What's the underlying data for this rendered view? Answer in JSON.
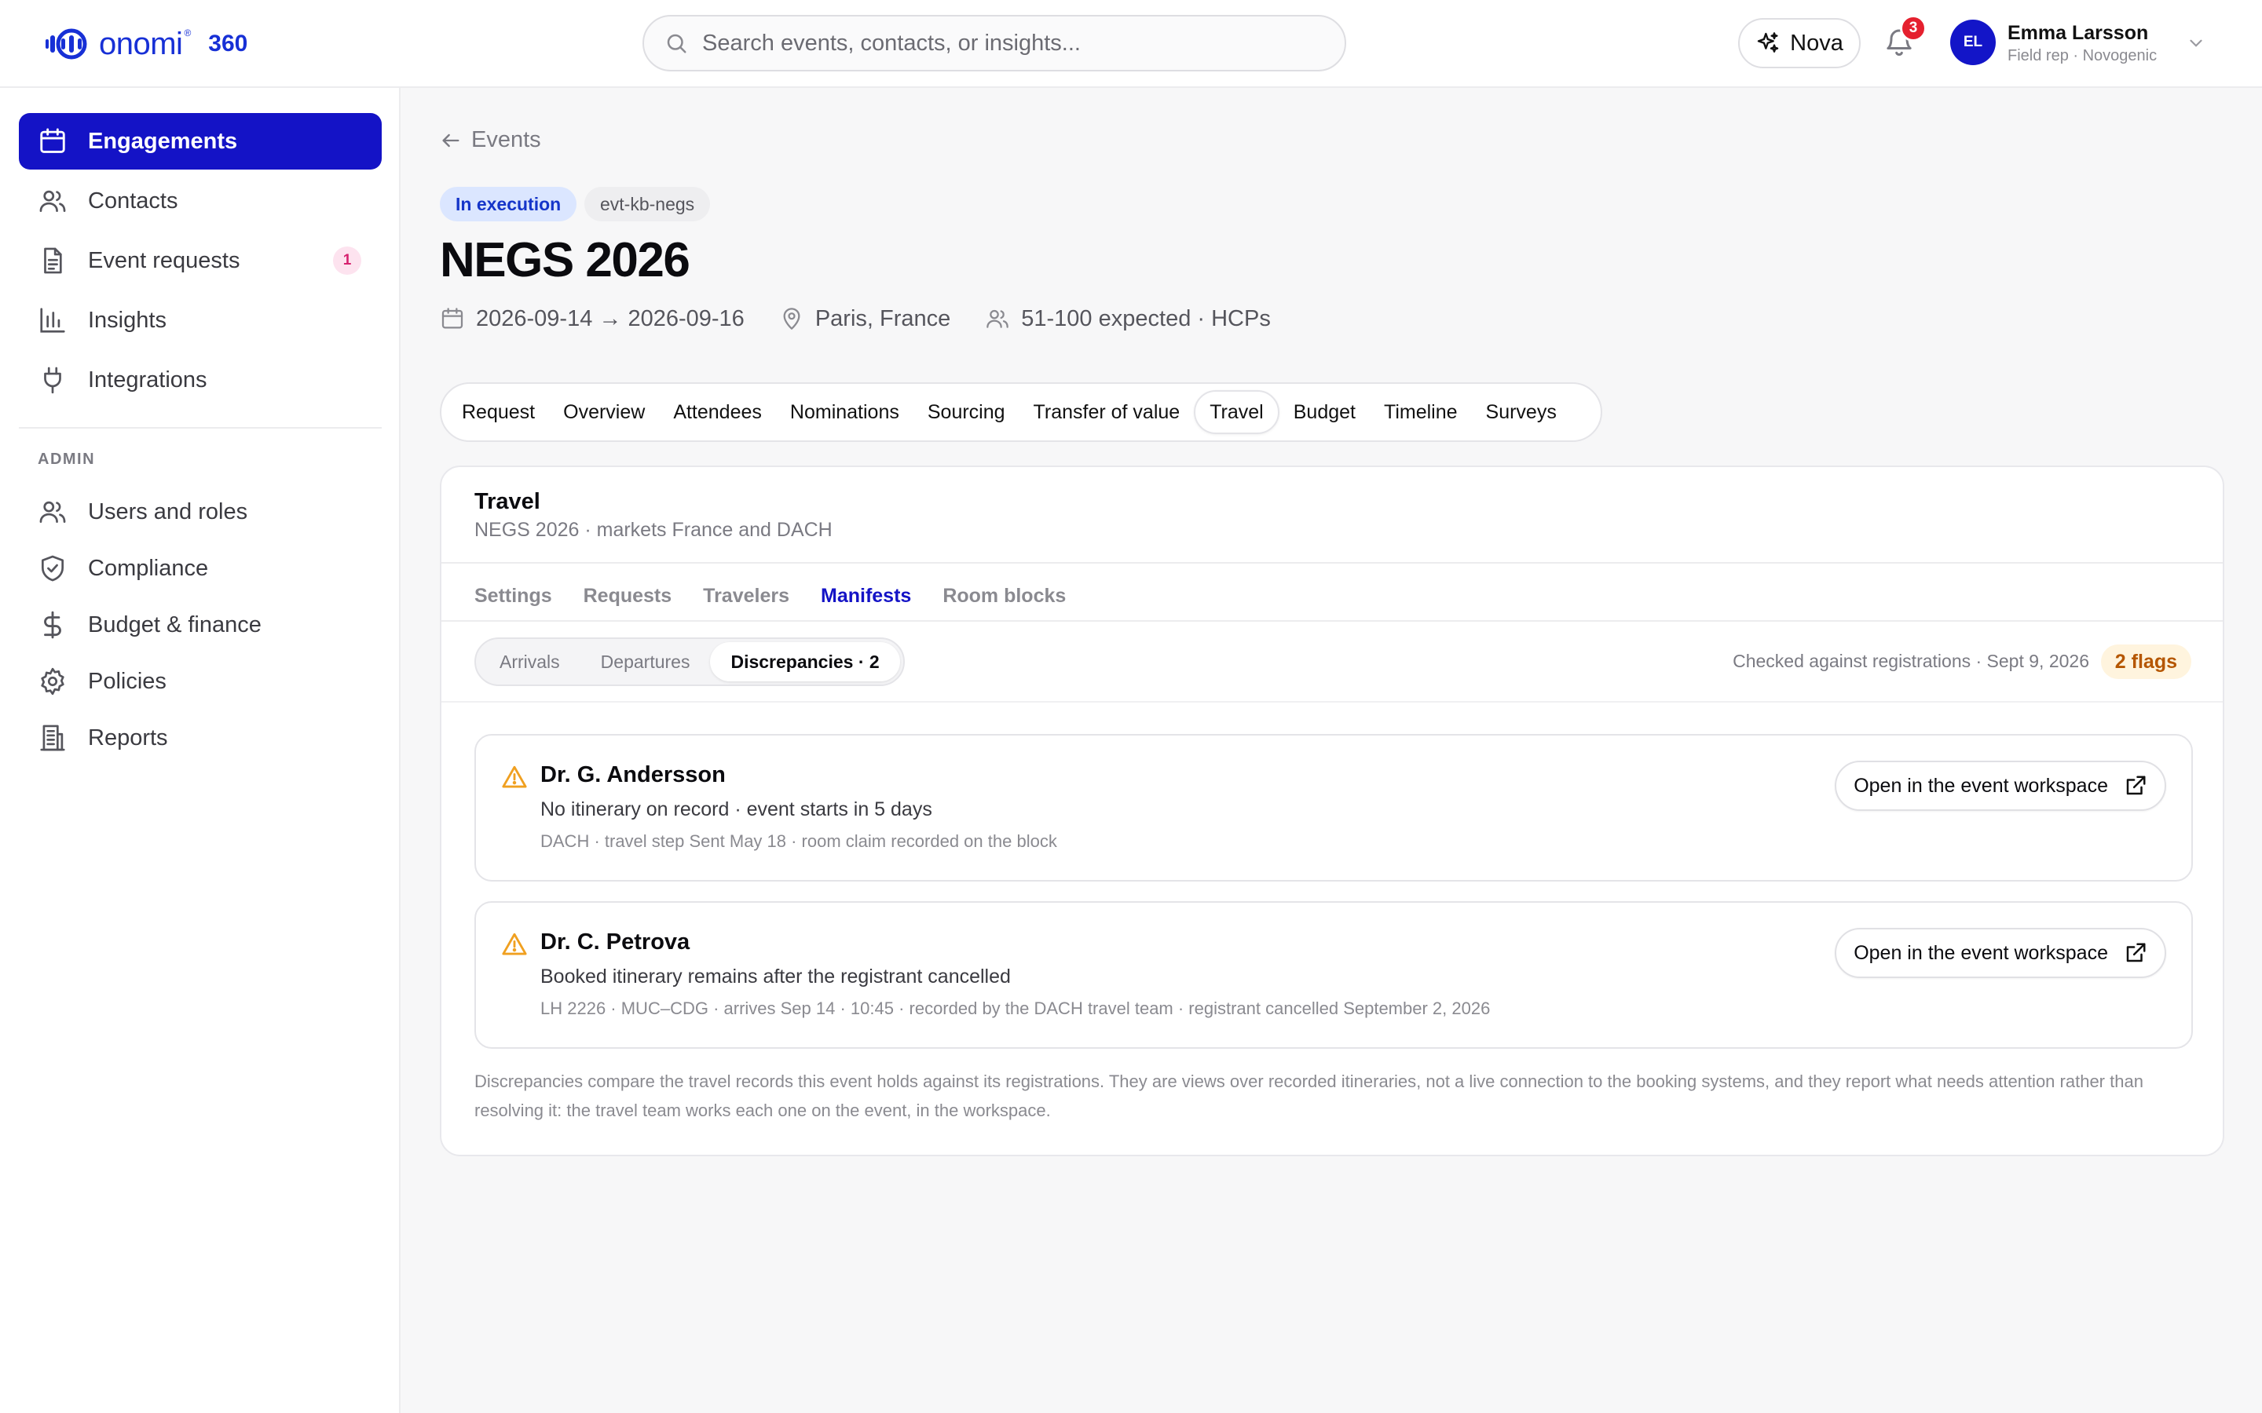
{
  "brand": {
    "word": "onomi",
    "reg": "®",
    "suffix": "360",
    "accent": "#1730d6"
  },
  "search": {
    "placeholder": "Search events, contacts, or insights..."
  },
  "header": {
    "nova_label": "Nova",
    "notifications_count": "3",
    "user": {
      "initials": "EL",
      "name": "Emma Larsson",
      "role": "Field rep · Novogenic"
    }
  },
  "sidebar": {
    "items": [
      {
        "label": "Engagements",
        "icon": "calendar-icon",
        "active": true
      },
      {
        "label": "Contacts",
        "icon": "users-icon"
      },
      {
        "label": "Event requests",
        "icon": "document-icon",
        "badge": "1"
      },
      {
        "label": "Insights",
        "icon": "bar-chart-icon"
      },
      {
        "label": "Integrations",
        "icon": "plug-icon"
      }
    ],
    "admin_heading": "ADMIN",
    "admin_items": [
      {
        "label": "Users and roles",
        "icon": "users-icon"
      },
      {
        "label": "Compliance",
        "icon": "shield-check-icon"
      },
      {
        "label": "Budget & finance",
        "icon": "dollar-icon"
      },
      {
        "label": "Policies",
        "icon": "gear-icon"
      },
      {
        "label": "Reports",
        "icon": "building-icon"
      }
    ]
  },
  "page": {
    "back_label": "Events",
    "status": "In execution",
    "event_id": "evt-kb-negs",
    "title": "NEGS 2026",
    "dates": "2026-09-14 → 2026-09-16",
    "location": "Paris, France",
    "attendance": "51-100 expected · HCPs"
  },
  "tabs": [
    "Request",
    "Overview",
    "Attendees",
    "Nominations",
    "Sourcing",
    "Transfer of value",
    "Travel",
    "Budget",
    "Timeline",
    "Surveys"
  ],
  "active_tab": "Travel",
  "travel": {
    "title": "Travel",
    "subtitle": "NEGS 2026 · markets France and DACH",
    "subtabs": [
      "Settings",
      "Requests",
      "Travelers",
      "Manifests",
      "Room blocks"
    ],
    "active_subtab": "Manifests",
    "segments": [
      "Arrivals",
      "Departures",
      "Discrepancies · 2"
    ],
    "active_segment": "Discrepancies · 2",
    "checked_note": "Checked against registrations · Sept 9, 2026",
    "flags": "2 flags",
    "discrepancies": [
      {
        "name": "Dr. G. Andersson",
        "description": "No itinerary on record · event starts in 5 days",
        "detail": "DACH · travel step Sent May 18 · room claim recorded on the block",
        "action": "Open in the event workspace"
      },
      {
        "name": "Dr. C. Petrova",
        "description": "Booked itinerary remains after the registrant cancelled",
        "detail": "LH 2226 · MUC–CDG · arrives Sep 14 · 10:45 · recorded by the DACH travel team · registrant cancelled September 2, 2026",
        "action": "Open in the event workspace"
      }
    ],
    "footnote": "Discrepancies compare the travel records this event holds against its registrations. They are views over recorded itineraries, not a live connection to the booking systems, and they report what needs attention rather than resolving it: the travel team works each one on the event, in the workspace."
  },
  "colors": {
    "primary": "#1413c6",
    "warning": "#f0a020",
    "flag_text": "#b55600",
    "flag_bg": "#fff4de",
    "badge_red": "#e5202e"
  }
}
